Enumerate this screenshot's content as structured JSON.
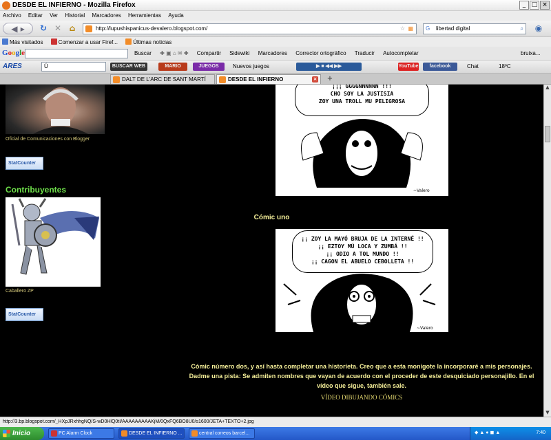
{
  "window": {
    "title": "DESDE EL INFIERNO - Mozilla Firefox"
  },
  "menubar": {
    "items": [
      "Archivo",
      "Editar",
      "Ver",
      "Historial",
      "Marcadores",
      "Herramientas",
      "Ayuda"
    ]
  },
  "navbar": {
    "url": "http://lupushispanicus-devalero.blogspot.com/",
    "search_value": "libertad digital"
  },
  "bookmarks": {
    "items": [
      "Más visitados",
      "Comenzar a usar Firef...",
      "Últimas noticias"
    ]
  },
  "googlebar": {
    "logo": "Google",
    "items": [
      "Buscar",
      "Compartir",
      "Sidewiki",
      "Marcadores",
      "Corrector ortográfico",
      "Traducir",
      "Autocompletar",
      "bruixa..."
    ]
  },
  "aresbar": {
    "logo": "ARES",
    "search_value": "Ú",
    "buscar_web": "BUSCAR WEB",
    "nuevos_juegos": "Nuevos juegos",
    "chat": "Chat",
    "temp": "18ºC",
    "youtube": "YouTube"
  },
  "tabs": [
    {
      "label": "DALT DE L'ARC DE SANT MARTÍ",
      "active": false
    },
    {
      "label": "DESDE EL INFIERNO",
      "active": true
    }
  ],
  "sidebar": {
    "photo_caption": "Oficial de Comunicaciones con Blogger",
    "statcounter": "StatCounter",
    "contrib_heading": "Contribuyentes",
    "knight_caption": "Caballero ZP"
  },
  "comic1": {
    "bubble": "¡¡¡ GGGGNNNNNN !!!\nCHO SOY LA JUSTISIA\nZOY UNA TROLL MU PELIGROSA"
  },
  "caption1": "Cómic uno",
  "comic2": {
    "bubble": "¡¡ ZOY LA MAYÓ BRUJA DE LA INTERNÉ !!\n¡¡ EZTOY MÚ LOCA Y ZUMBÁ !!\n¡¡ ODIO A TOL MUNDO !!\n¡¡ CAGON EL ABUELO CEBOLLETA !!"
  },
  "paragraph": "Cómic número dos, y así hasta completar una historieta. Creo que a esta monigote la incorporaré a mis personajes. Dadme una pista: Se admiten nombres que vayan de acuerdo con el proceder de este desquiciado personajillo. En el vídeo que sigue, también sale.",
  "video_link": "VÍDEO DIBUJANDO CÓMICS",
  "statusbar": {
    "text": "http://3.bp.blogspot.com/_HXpJRxhhgNQ/S-wD0HlQ0tI/AAAAAAAAAKjM/0QxFQ6BO8U0/s1600/JETA+TEXTO+2.jpg"
  },
  "taskbar": {
    "start": "Inicio",
    "tasks": [
      "PC Alarm Clock",
      "DESDE EL INFIERNO ...",
      "central correos barcel..."
    ],
    "lang": "ES",
    "clock": "7:40"
  }
}
